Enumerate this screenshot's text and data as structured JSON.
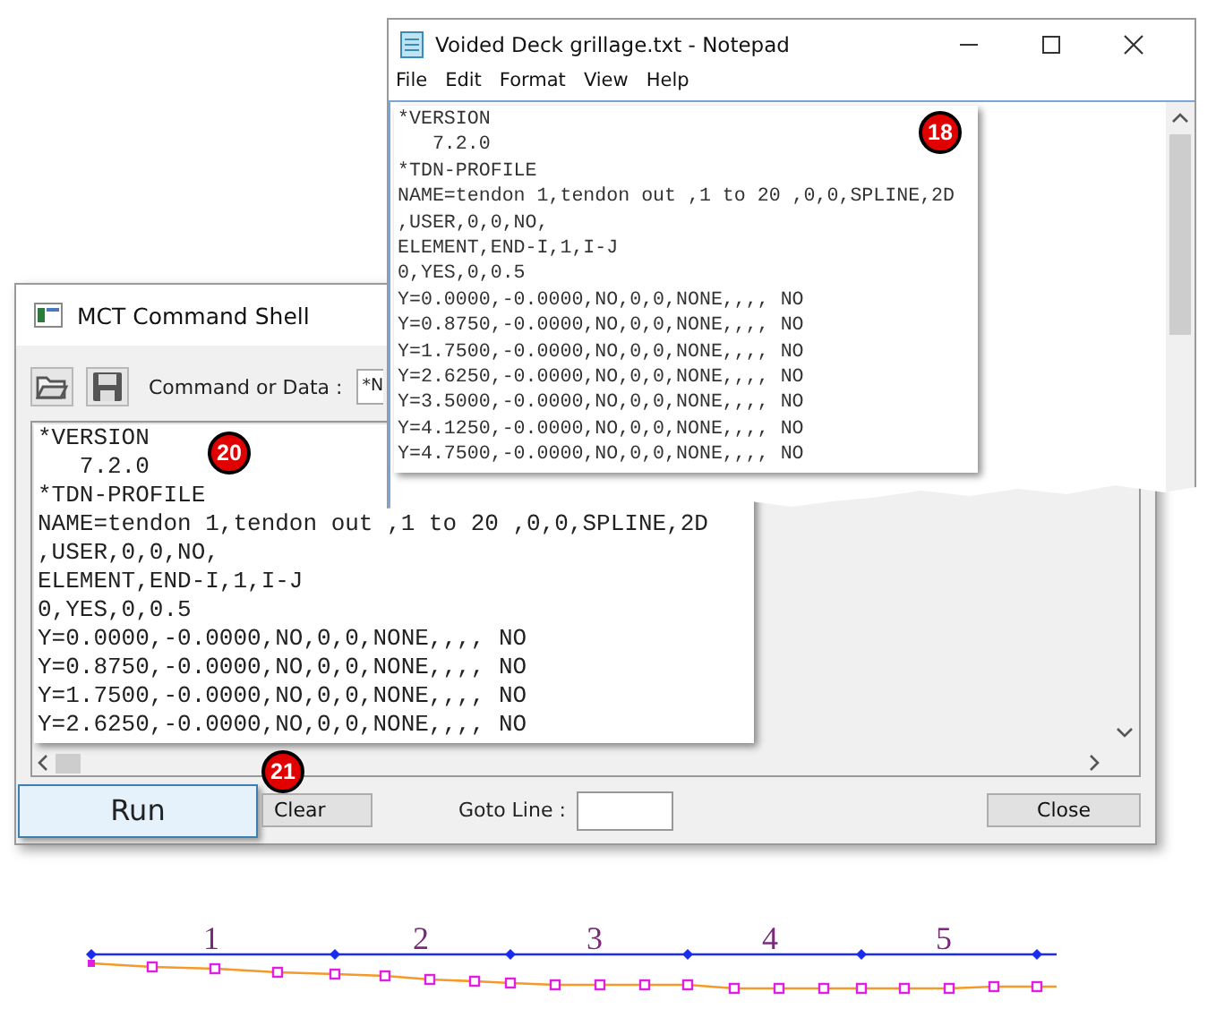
{
  "notepad": {
    "title": "Voided Deck grillage.txt - Notepad",
    "menu": [
      "File",
      "Edit",
      "Format",
      "View",
      "Help"
    ],
    "badge": "18",
    "lines": [
      "*VERSION",
      "   7.2.0",
      "*TDN-PROFILE",
      "NAME=tendon 1,tendon out ,1 to 20 ,0,0,SPLINE,2D",
      ",USER,0,0,NO,",
      "ELEMENT,END-I,1,I-J",
      "0,YES,0,0.5",
      "Y=0.0000,-0.0000,NO,0,0,NONE,,,, NO",
      "Y=0.8750,-0.0000,NO,0,0,NONE,,,, NO",
      "Y=1.7500,-0.0000,NO,0,0,NONE,,,, NO",
      "Y=2.6250,-0.0000,NO,0,0,NONE,,,, NO",
      "Y=3.5000,-0.0000,NO,0,0,NONE,,,, NO",
      "Y=4.1250,-0.0000,NO,0,0,NONE,,,, NO",
      "Y=4.7500,-0.0000,NO,0,0,NONE,,,, NO"
    ]
  },
  "shell": {
    "title": "MCT Command Shell",
    "command_label": "Command or Data :",
    "command_value": "*N",
    "badge": "20",
    "run_badge": "21",
    "lines": [
      "*VERSION",
      "   7.2.0",
      "*TDN-PROFILE",
      "NAME=tendon 1,tendon out ,1 to 20 ,0,0,SPLINE,2D",
      ",USER,0,0,NO,",
      "ELEMENT,END-I,1,I-J",
      "0,YES,0,0.5",
      "Y=0.0000,-0.0000,NO,0,0,NONE,,,, NO",
      "Y=0.8750,-0.0000,NO,0,0,NONE,,,, NO",
      "Y=1.7500,-0.0000,NO,0,0,NONE,,,, NO",
      "Y=2.6250,-0.0000,NO,0,0,NONE,,,, NO"
    ],
    "run": "Run",
    "clear": "Clear",
    "goto_label": "Goto Line :",
    "close": "Close"
  },
  "diagram": {
    "element_labels": [
      "1",
      "2",
      "3",
      "4",
      "5"
    ]
  }
}
